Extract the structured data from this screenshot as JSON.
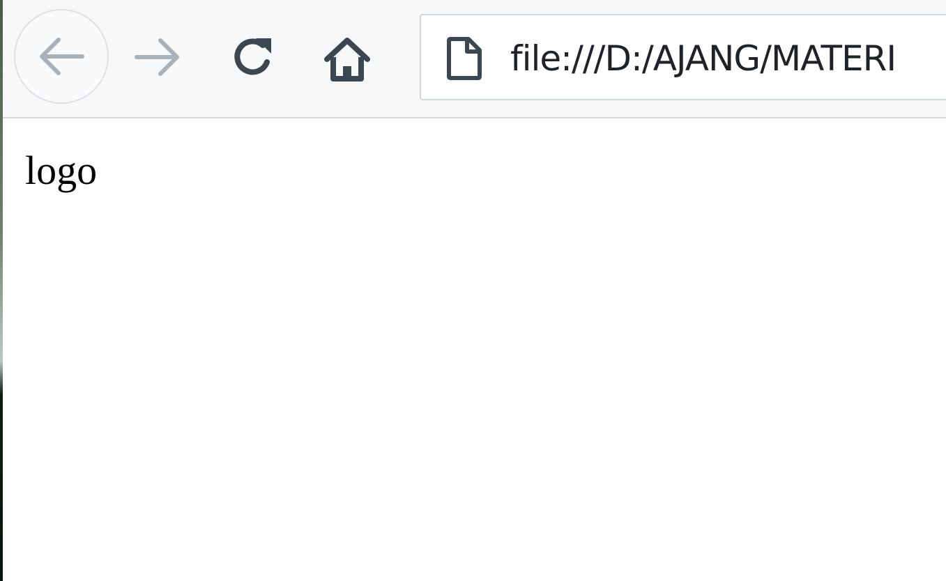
{
  "toolbar": {
    "back_icon": "arrow-left-icon",
    "forward_icon": "arrow-right-icon",
    "reload_icon": "reload-icon",
    "home_icon": "home-icon"
  },
  "urlbar": {
    "page_icon": "page-icon",
    "url": "file:///D:/AJANG/MATERI"
  },
  "page": {
    "logo_text": "logo"
  },
  "colors": {
    "toolbar_bg": "#f7f8fa",
    "icon_disabled": "#a9b2b9",
    "icon_active": "#3b4651",
    "text": "#000000"
  }
}
